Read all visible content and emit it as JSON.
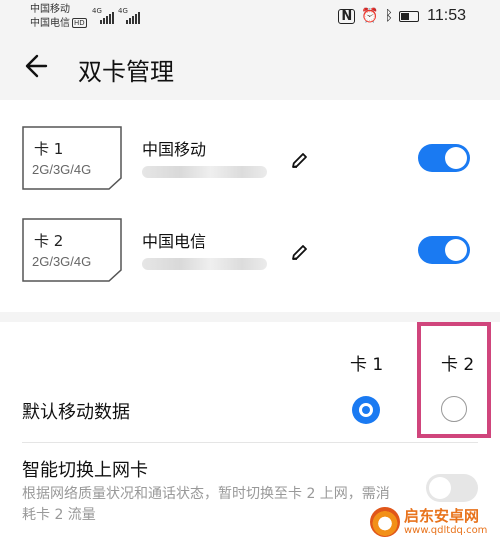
{
  "status_bar": {
    "carrier1": "中国移动",
    "carrier2": "中国电信",
    "hd_badge": "HD",
    "signal1_label": "4G",
    "signal2_label": "4G",
    "time": "11:53"
  },
  "header": {
    "title": "双卡管理"
  },
  "sims": [
    {
      "slot": "卡 1",
      "network": "2G/3G/4G",
      "operator": "中国移动",
      "enabled": true
    },
    {
      "slot": "卡 2",
      "network": "2G/3G/4G",
      "operator": "中国电信",
      "enabled": true
    }
  ],
  "default_data": {
    "col1": "卡 1",
    "col2": "卡 2",
    "label": "默认移动数据",
    "selected": "卡 1"
  },
  "smart_switch": {
    "title": "智能切换上网卡",
    "description": "根据网络质量状况和通话状态，暂时切换至卡 2 上网，需消耗卡 2 流量",
    "enabled": false
  },
  "watermark": {
    "name": "启东安卓网",
    "url": "www.qdltdq.com"
  },
  "colors": {
    "accent": "#1a7af2",
    "highlight": "#d0457c"
  }
}
